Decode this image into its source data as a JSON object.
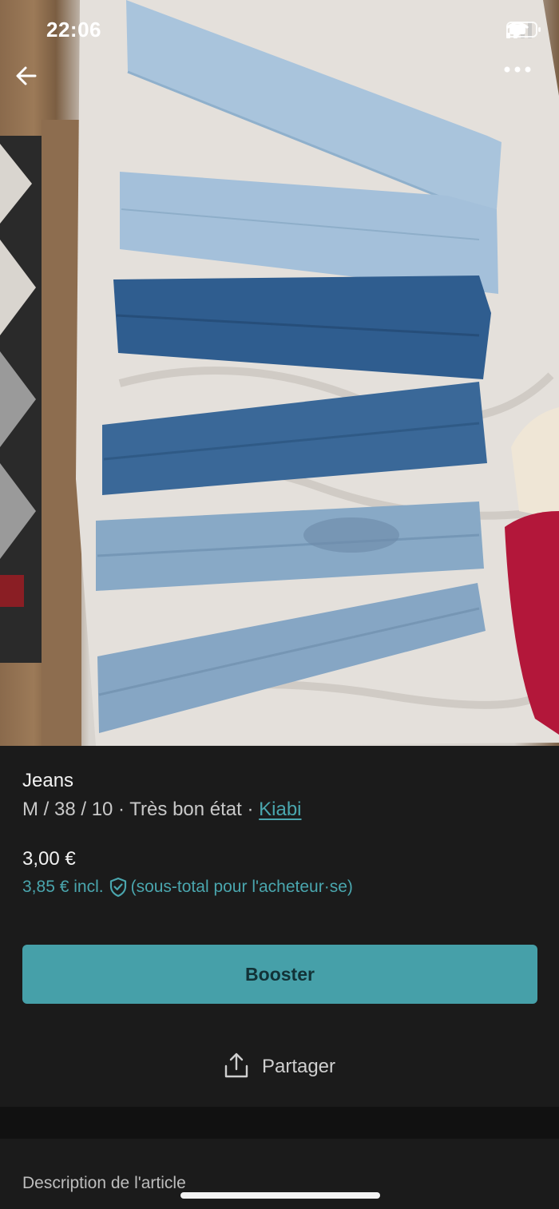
{
  "status_bar": {
    "time": "22:06",
    "icons": [
      "signal-icon",
      "wifi-icon",
      "battery-icon"
    ]
  },
  "top_bar": {
    "back_icon": "arrow-left-icon",
    "more_icon": "more-horizontal-icon"
  },
  "listing": {
    "title": "Jeans",
    "size_line": "M / 38 / 10 · Très bon état · ",
    "brand": "Kiabi",
    "price": "3,00 €",
    "buyer_price": "3,85 € incl.",
    "buyer_price_note": "(sous-total pour l'acheteur·se)",
    "shield_icon": "shield-check-icon"
  },
  "actions": {
    "booster_label": "Booster",
    "share_label": "Partager",
    "share_icon": "share-upload-icon"
  },
  "description": {
    "label": "Description de l'article"
  },
  "colors": {
    "accent": "#46a0a9",
    "accent_text": "#4aa6ae",
    "background": "#1b1b1b"
  }
}
